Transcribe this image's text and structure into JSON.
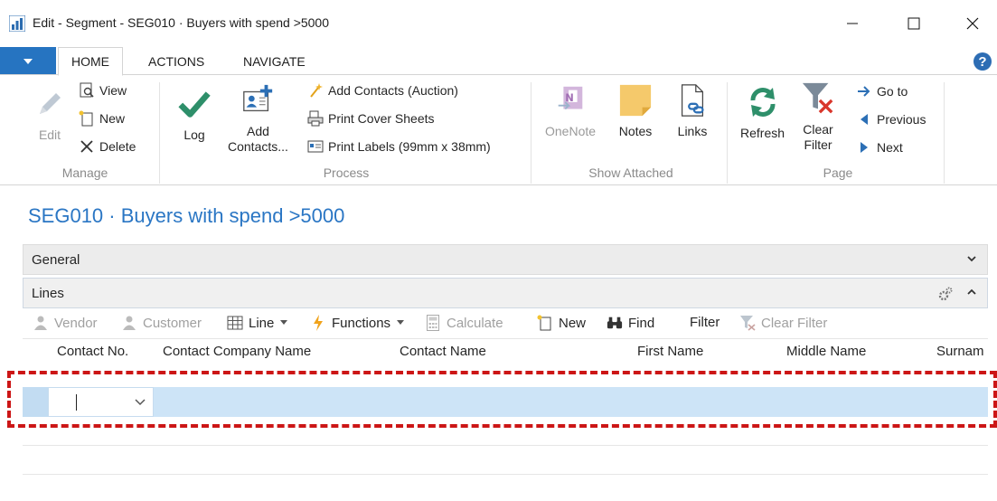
{
  "window": {
    "title": "Edit - Segment - SEG010 · Buyers with spend >5000",
    "controls": [
      "minimize",
      "maximize",
      "close"
    ]
  },
  "tabs": [
    "HOME",
    "ACTIONS",
    "NAVIGATE"
  ],
  "active_tab": "HOME",
  "ribbon": {
    "manage": {
      "label": "Manage",
      "edit": "Edit",
      "view": "View",
      "new": "New",
      "delete": "Delete"
    },
    "process": {
      "label": "Process",
      "log": "Log",
      "add_contacts_line1": "Add",
      "add_contacts_line2": "Contacts...",
      "add_contacts_auction": "Add Contacts (Auction)",
      "print_cover_sheets": "Print Cover Sheets",
      "print_labels": "Print Labels (99mm x 38mm)"
    },
    "show_attached": {
      "label": "Show Attached",
      "onenote": "OneNote",
      "notes": "Notes",
      "links": "Links"
    },
    "page": {
      "label": "Page",
      "refresh": "Refresh",
      "clear_filter_line1": "Clear",
      "clear_filter_line2": "Filter",
      "go_to": "Go to",
      "previous": "Previous",
      "next": "Next"
    }
  },
  "page_title": "SEG010 · Buyers with spend >5000",
  "fasttabs": {
    "general": "General",
    "lines": "Lines"
  },
  "lines_toolbar": {
    "vendor": "Vendor",
    "customer": "Customer",
    "line": "Line",
    "functions": "Functions",
    "calculate": "Calculate",
    "new": "New",
    "find": "Find",
    "filter": "Filter",
    "clear_filter": "Clear Filter"
  },
  "columns": [
    "Contact No.",
    "Contact Company Name",
    "Contact Name",
    "First Name",
    "Middle Name",
    "Surnam"
  ],
  "colors": {
    "accent": "#2674c1",
    "title_blue": "#2a76c4",
    "selected_row": "#cde4f7",
    "highlight": "#cc1616"
  }
}
